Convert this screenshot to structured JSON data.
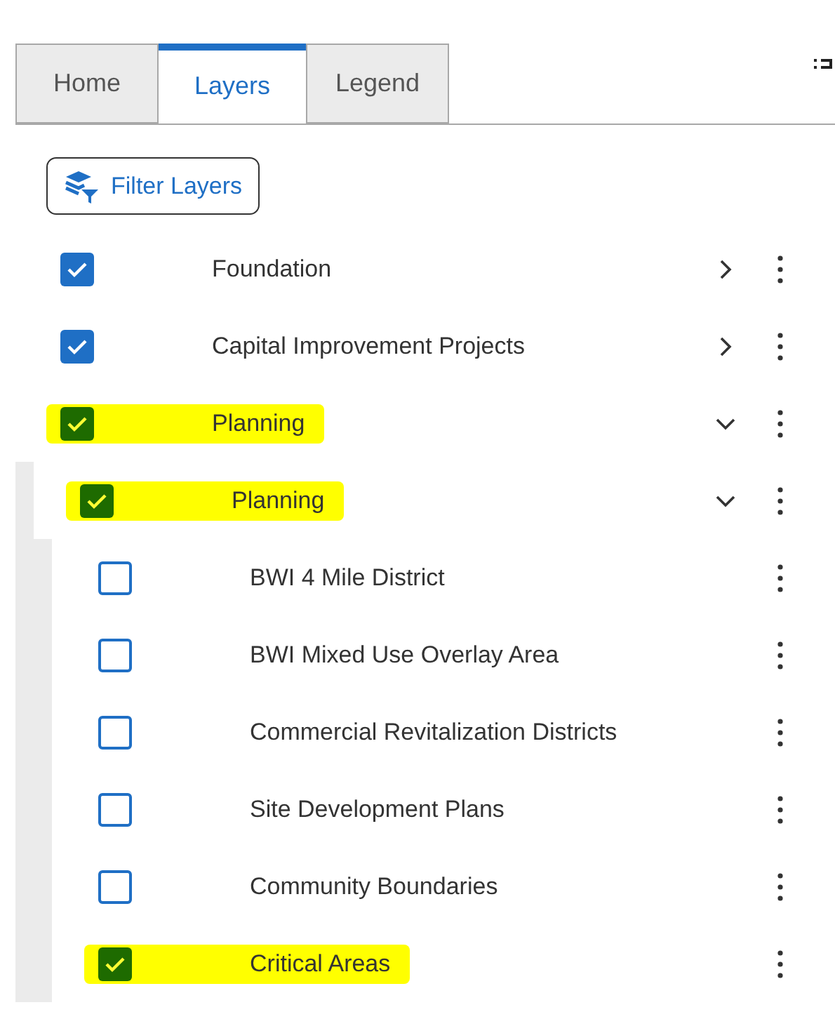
{
  "tabs": [
    {
      "label": "Home",
      "selected": false
    },
    {
      "label": "Layers",
      "selected": true
    },
    {
      "label": "Legend",
      "selected": false
    }
  ],
  "filter_button": {
    "label": "Filter Layers"
  },
  "layers": [
    {
      "label": "Foundation",
      "checked": true,
      "highlighted": false,
      "expanded": false
    },
    {
      "label": "Capital Improvement Projects",
      "checked": true,
      "highlighted": false,
      "expanded": false
    },
    {
      "label": "Planning",
      "checked": true,
      "highlighted": true,
      "expanded": true,
      "children": [
        {
          "label": "Planning",
          "checked": true,
          "highlighted": true,
          "expanded": true,
          "children": [
            {
              "label": "BWI 4 Mile District",
              "checked": false,
              "highlighted": false
            },
            {
              "label": "BWI Mixed Use Overlay Area",
              "checked": false,
              "highlighted": false
            },
            {
              "label": "Commercial Revitalization Districts",
              "checked": false,
              "highlighted": false
            },
            {
              "label": "Site Development Plans",
              "checked": false,
              "highlighted": false
            },
            {
              "label": "Community Boundaries",
              "checked": false,
              "highlighted": false
            },
            {
              "label": "Critical Areas",
              "checked": true,
              "highlighted": true
            }
          ]
        }
      ]
    }
  ]
}
